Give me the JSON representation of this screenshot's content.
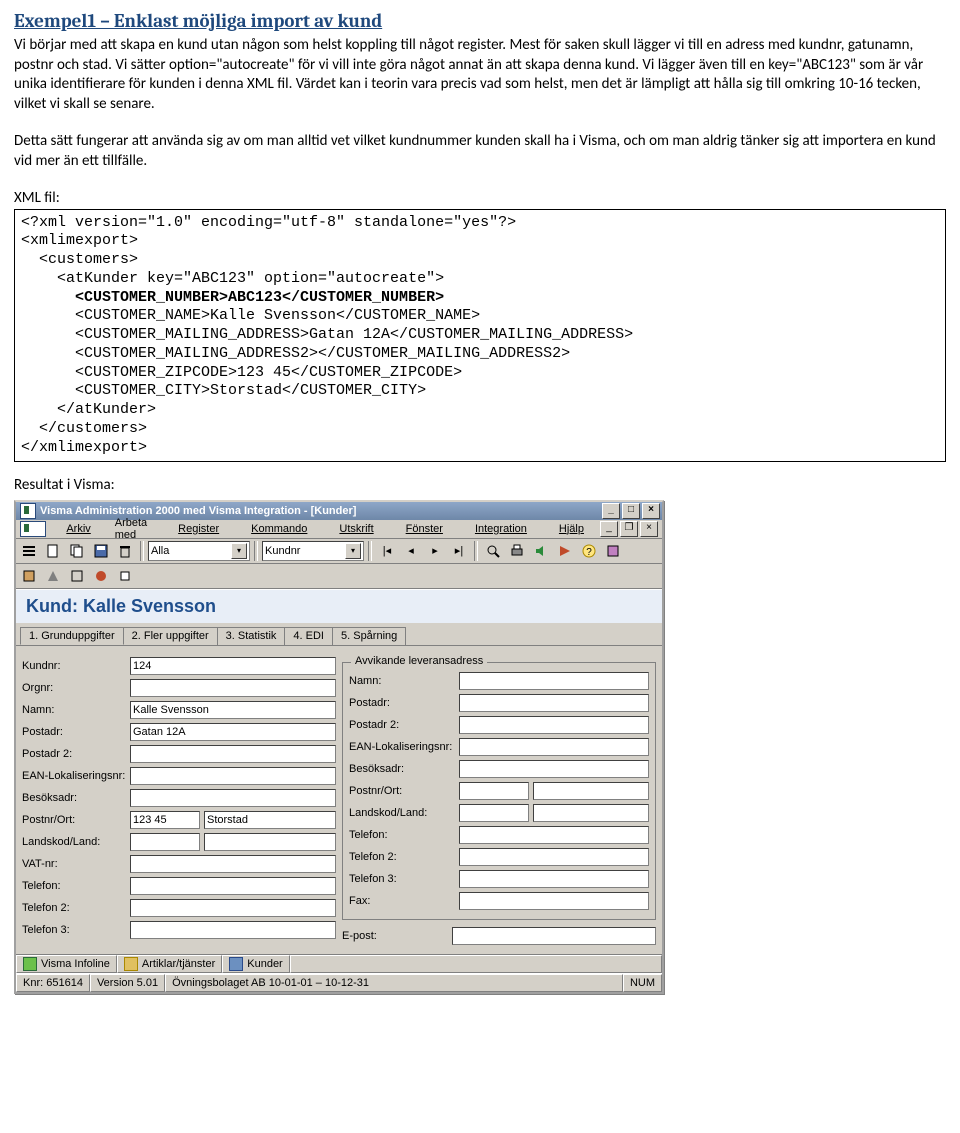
{
  "heading": "Exempel1 – Enklast möjliga import av kund",
  "para1": "Vi börjar med att skapa en kund utan någon som helst koppling till något register. Mest för saken skull lägger vi till en adress med kundnr, gatunamn, postnr och stad. Vi sätter option=\"autocreate\" för vi vill inte göra något annat än att skapa denna kund. Vi lägger även till en key=\"ABC123\" som är vår unika identifierare för kunden i denna XML fil. Värdet kan i teorin vara precis vad som helst, men det är lämpligt att hålla sig till omkring 10-16 tecken, vilket vi skall se senare.",
  "para2": "Detta sätt fungerar att använda sig av om man alltid vet vilket kundnummer kunden skall ha i Visma, och om man aldrig tänker sig att importera en kund vid mer än ett tillfälle.",
  "xml_label": "XML fil:",
  "xml": {
    "l1": "<?xml version=\"1.0\" encoding=\"utf-8\" standalone=\"yes\"?>",
    "l2": "<xmlimexport>",
    "l3": "  <customers>",
    "l4": "    <atKunder key=\"ABC123\" option=\"autocreate\">",
    "l5": "      <CUSTOMER_NUMBER>ABC123</CUSTOMER_NUMBER>",
    "l6": "      <CUSTOMER_NAME>Kalle Svensson</CUSTOMER_NAME>",
    "l7": "      <CUSTOMER_MAILING_ADDRESS>Gatan 12A</CUSTOMER_MAILING_ADDRESS>",
    "l8": "      <CUSTOMER_MAILING_ADDRESS2></CUSTOMER_MAILING_ADDRESS2>",
    "l9": "      <CUSTOMER_ZIPCODE>123 45</CUSTOMER_ZIPCODE>",
    "l10": "      <CUSTOMER_CITY>Storstad</CUSTOMER_CITY>",
    "l11": "    </atKunder>",
    "l12": "  </customers>",
    "l13": "</xmlimexport>"
  },
  "result_label": "Resultat i Visma:",
  "win": {
    "title": "Visma Administration 2000 med Visma Integration - [Kunder]",
    "menu": [
      "Arkiv",
      "Arbeta med",
      "Register",
      "Kommando",
      "Utskrift",
      "Fönster",
      "Integration",
      "Hjälp"
    ],
    "combo1": "Alla",
    "combo2": "Kundnr",
    "bluebar": "Kund: Kalle Svensson",
    "tabs": [
      "1. Grunduppgifter",
      "2. Fler uppgifter",
      "3. Statistik",
      "4. EDI",
      "5. Spårning"
    ],
    "left": {
      "kundnr_l": "Kundnr:",
      "kundnr_v": "124",
      "orgnr_l": "Orgnr:",
      "orgnr_v": "",
      "namn_l": "Namn:",
      "namn_v": "Kalle Svensson",
      "postadr_l": "Postadr:",
      "postadr_v": "Gatan 12A",
      "postadr2_l": "Postadr 2:",
      "postadr2_v": "",
      "ean_l": "EAN-Lokaliseringsnr:",
      "ean_v": "",
      "besok_l": "Besöksadr:",
      "besok_v": "",
      "postnrort_l": "Postnr/Ort:",
      "postnr_v": "123 45",
      "ort_v": "Storstad",
      "land_l": "Landskod/Land:",
      "land1_v": "",
      "land2_v": "",
      "vat_l": "VAT-nr:",
      "vat_v": "",
      "tel_l": "Telefon:",
      "tel_v": "",
      "tel2_l": "Telefon 2:",
      "tel2_v": "",
      "tel3_l": "Telefon 3:",
      "tel3_v": ""
    },
    "right": {
      "group_label": "Avvikande leveransadress",
      "namn_l": "Namn:",
      "namn_v": "",
      "postadr_l": "Postadr:",
      "postadr_v": "",
      "postadr2_l": "Postadr 2:",
      "postadr2_v": "",
      "ean_l": "EAN-Lokaliseringsnr:",
      "ean_v": "",
      "besok_l": "Besöksadr:",
      "besok_v": "",
      "postnrort_l": "Postnr/Ort:",
      "postnr_v": "",
      "ort_v": "",
      "land_l": "Landskod/Land:",
      "land1_v": "",
      "land2_v": "",
      "tel_l": "Telefon:",
      "tel_v": "",
      "tel2_l": "Telefon 2:",
      "tel2_v": "",
      "tel3_l": "Telefon 3:",
      "tel3_v": "",
      "fax_l": "Fax:",
      "fax_v": "",
      "epost_l": "E-post:",
      "epost_v": ""
    },
    "status": {
      "infoline": "Visma Infoline",
      "artiklar": "Artiklar/tjänster",
      "kunder": "Kunder",
      "knr": "Knr: 651614",
      "ver": "Version 5.01",
      "bolag": "Övningsbolaget AB   10-01-01 – 10-12-31",
      "num": "NUM"
    }
  }
}
